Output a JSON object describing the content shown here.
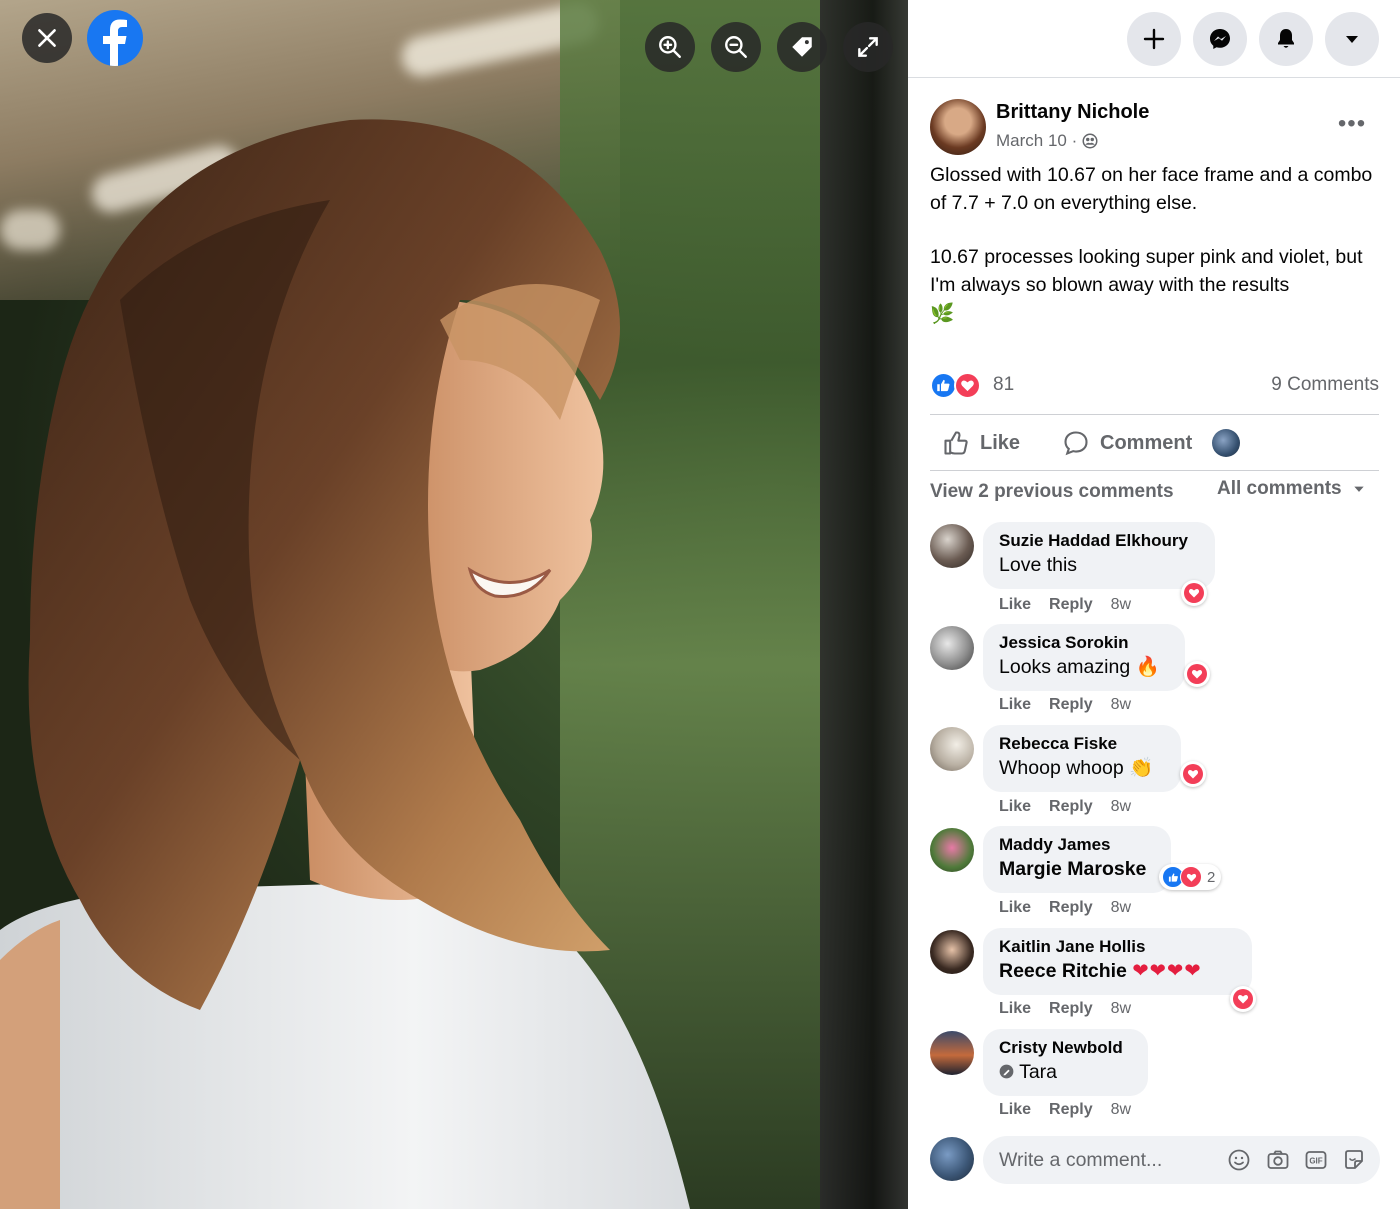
{
  "viewer": {
    "close_icon": "close-icon",
    "brand_icon": "facebook-logo-icon",
    "tools": [
      "zoom-in-icon",
      "zoom-out-icon",
      "tag-icon",
      "fullscreen-icon"
    ]
  },
  "topbar": {
    "buttons": [
      "plus-icon",
      "messenger-icon",
      "bell-icon",
      "caret-down-icon"
    ]
  },
  "post": {
    "author": "Brittany Nichole",
    "date": "March 10 ·",
    "text_p1": "Glossed with 10.67 on her face frame and a combo of 7.7 + 7.0 on everything else.",
    "text_p2": "10.67 processes looking super pink and violet, but I'm always so blown away with the results",
    "text_emoji": "🌿",
    "reaction_count": "81",
    "comments_count": "9 Comments",
    "like_label": "Like",
    "comment_label": "Comment"
  },
  "comments_section": {
    "view_previous": "View 2 previous comments",
    "filter": "All comments",
    "items": [
      {
        "name": "Suzie Haddad Elkhoury",
        "text": "Love this",
        "like": "Like",
        "reply": "Reply",
        "time": "8w"
      },
      {
        "name": "Jessica Sorokin",
        "text": "Looks amazing 🔥",
        "like": "Like",
        "reply": "Reply",
        "time": "8w"
      },
      {
        "name": "Rebecca Fiske",
        "text": "Whoop whoop 👏",
        "like": "Like",
        "reply": "Reply",
        "time": "8w"
      },
      {
        "name": "Maddy James",
        "text": "Margie Maroske",
        "like": "Like",
        "reply": "Reply",
        "time": "8w",
        "reaction_count": "2"
      },
      {
        "name": "Kaitlin Jane Hollis",
        "text": "Reece Ritchie",
        "hearts": "❤❤❤❤",
        "like": "Like",
        "reply": "Reply",
        "time": "8w"
      },
      {
        "name": "Cristy Newbold",
        "text": "Tara",
        "like": "Like",
        "reply": "Reply",
        "time": "8w"
      }
    ]
  },
  "composer": {
    "placeholder": "Write a comment...",
    "icons": [
      "emoji-icon",
      "camera-icon",
      "gif-icon",
      "sticker-icon"
    ]
  },
  "colors": {
    "brand": "#1877f2",
    "love": "#f33e58",
    "muted_text": "#65676b",
    "bubble_bg": "#f0f2f5"
  }
}
